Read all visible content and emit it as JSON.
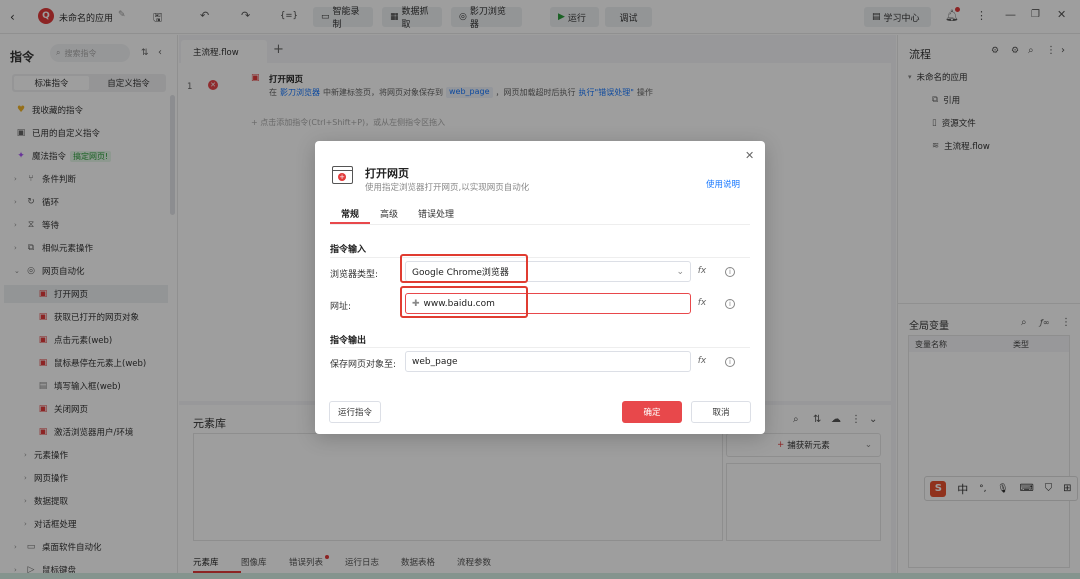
{
  "titlebar": {
    "app_name": "未命名的应用",
    "btn_record": "智能录制",
    "btn_grab": "数据抓取",
    "btn_browser": "影刀浏览器",
    "btn_run": "运行",
    "btn_debug": "调试",
    "btn_learn": "学习中心",
    "expr_icon": "{=}"
  },
  "left": {
    "title": "指令",
    "search_placeholder": "搜索指令",
    "seg_standard": "标准指令",
    "seg_custom": "自定义指令",
    "items": [
      {
        "label": "我收藏的指令",
        "icon": "♥"
      },
      {
        "label": "已用的自定义指令",
        "icon": "▣"
      },
      {
        "label": "魔法指令",
        "icon": "✦",
        "badge": "搞定网页!"
      },
      {
        "label": "条件判断",
        "icon": "⑂"
      },
      {
        "label": "循环",
        "icon": "↻"
      },
      {
        "label": "等待",
        "icon": "⧖"
      },
      {
        "label": "相似元素操作",
        "icon": "⧉"
      },
      {
        "label": "网页自动化",
        "icon": "◎"
      },
      {
        "label": "打开网页",
        "icon": "▣"
      },
      {
        "label": "获取已打开的网页对象",
        "icon": "▣"
      },
      {
        "label": "点击元素(web)",
        "icon": "▣"
      },
      {
        "label": "鼠标悬停在元素上(web)",
        "icon": "▣"
      },
      {
        "label": "填写输入框(web)",
        "icon": "▤"
      },
      {
        "label": "关闭网页",
        "icon": "▣"
      },
      {
        "label": "激活浏览器用户/环境",
        "icon": "▣"
      },
      {
        "label": "元素操作"
      },
      {
        "label": "网页操作"
      },
      {
        "label": "数据提取"
      },
      {
        "label": "对话框处理"
      },
      {
        "label": "桌面软件自动化",
        "icon": "▭"
      },
      {
        "label": "鼠标键盘",
        "icon": "▷"
      }
    ]
  },
  "center": {
    "tab_main": "主流程.flow",
    "line_no": "1",
    "cmd_title": "打开网页",
    "cmd_desc_1": "在",
    "cmd_desc_browser": "影刀浏览器",
    "cmd_desc_2": "中新建标签页，将网页对象保存到",
    "cmd_desc_var": "web_page",
    "cmd_desc_3": "，网页加载超时后执行",
    "cmd_desc_err": "执行\"错误处理\"",
    "cmd_desc_4": "操作",
    "add_hint": "+ 点击添加指令(Ctrl+Shift+P)，或从左侧指令区拖入",
    "lib_title": "元素库",
    "capture_btn": "捕获新元素",
    "bottom_tabs": [
      "元素库",
      "图像库",
      "错误列表",
      "运行日志",
      "数据表格",
      "流程参数"
    ]
  },
  "right": {
    "flow_title": "流程",
    "app_node": "未命名的应用",
    "ref": "引用",
    "res": "资源文件",
    "main_flow": "主流程.flow",
    "globals_title": "全局变量",
    "col_name": "变量名称",
    "col_type": "类型"
  },
  "dialog": {
    "title": "打开网页",
    "subtitle": "使用指定浏览器打开网页,以实现网页自动化",
    "help": "使用说明",
    "tabs": [
      "常规",
      "高级",
      "错误处理"
    ],
    "section_input": "指令输入",
    "label_browser": "浏览器类型:",
    "value_browser": "Google Chrome浏览器",
    "label_url": "网址:",
    "value_url": "www.baidu.com",
    "section_output": "指令输出",
    "label_save": "保存网页对象至:",
    "value_save": "web_page",
    "btn_run_cmd": "运行指令",
    "btn_ok": "确定",
    "btn_cancel": "取消",
    "fx": "fx"
  },
  "ime": {
    "items": [
      "S",
      "中",
      "°,",
      "🎙",
      "⌨",
      "👕",
      "⊞"
    ]
  },
  "colors": {
    "accent_blue": "#1677ff",
    "danger_red": "#e8484b",
    "link_blue": "#1677ff"
  }
}
